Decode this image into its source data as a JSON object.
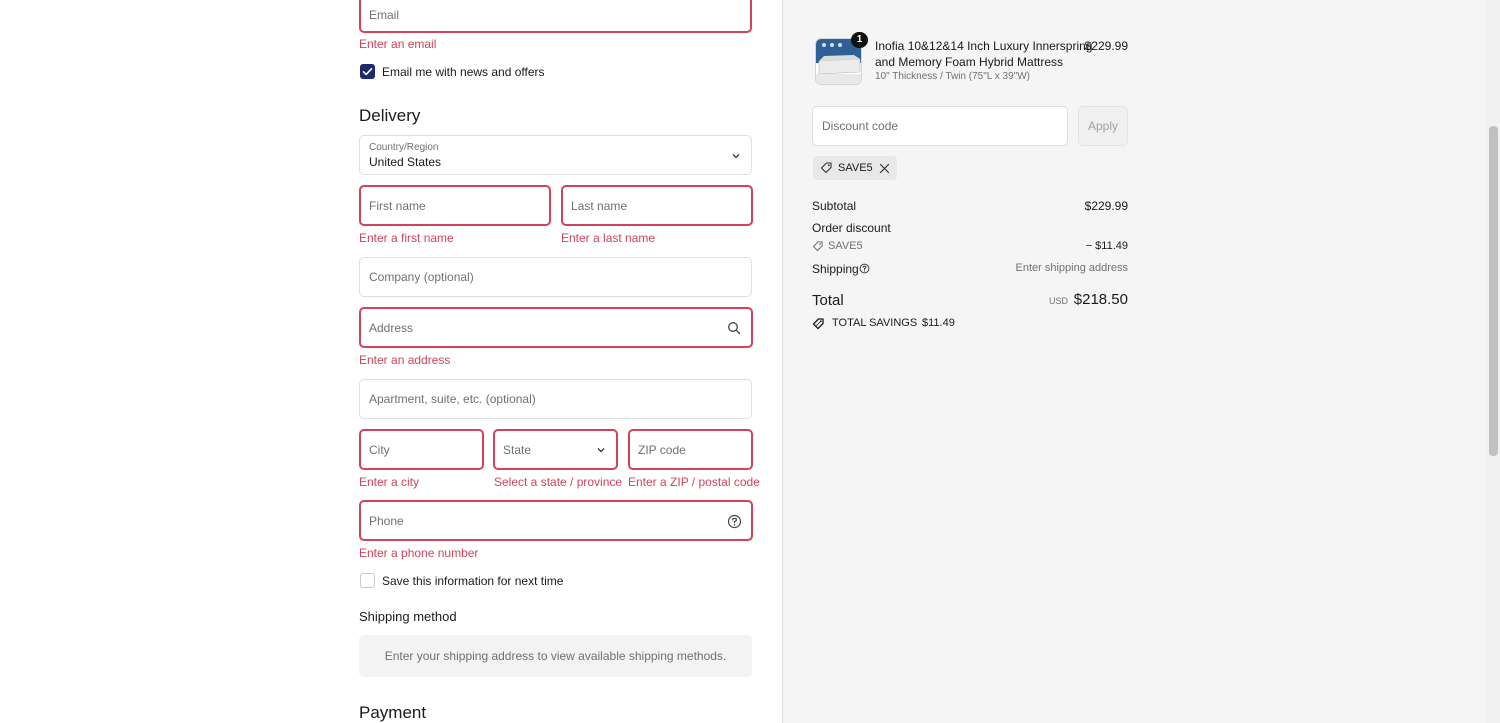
{
  "contact": {
    "email_placeholder": "Email",
    "email_error": "Enter an email",
    "news_label": "Email me with news and offers"
  },
  "delivery": {
    "heading": "Delivery",
    "country_label": "Country/Region",
    "country_value": "United States",
    "first_name_placeholder": "First name",
    "first_name_error": "Enter a first name",
    "last_name_placeholder": "Last name",
    "last_name_error": "Enter a last name",
    "company_placeholder": "Company (optional)",
    "address_placeholder": "Address",
    "address_error": "Enter an address",
    "apartment_placeholder": "Apartment, suite, etc. (optional)",
    "city_placeholder": "City",
    "city_error": "Enter a city",
    "state_placeholder": "State",
    "state_error": "Select a state / province",
    "zip_placeholder": "ZIP code",
    "zip_error": "Enter a ZIP / postal code",
    "phone_placeholder": "Phone",
    "phone_error": "Enter a phone number",
    "save_info_label": "Save this information for next time"
  },
  "shipping_method": {
    "heading": "Shipping method",
    "message": "Enter your shipping address to view available shipping methods."
  },
  "payment": {
    "heading": "Payment"
  },
  "summary": {
    "item": {
      "quantity": "1",
      "title_line1": "Inofia 10&12&14 Inch Luxury Innerspring",
      "title_line2": "and Memory Foam Hybrid Mattress",
      "variant": "10\" Thickness / Twin (75\"L x 39\"W)",
      "price": "$229.99"
    },
    "discount_placeholder": "Discount code",
    "apply_label": "Apply",
    "applied_code": "SAVE5",
    "subtotal_label": "Subtotal",
    "subtotal_value": "$229.99",
    "order_discount_label": "Order discount",
    "discount_code": "SAVE5",
    "discount_value": "− $11.49",
    "shipping_label": "Shipping",
    "shipping_value": "Enter shipping address",
    "total_label": "Total",
    "currency": "USD",
    "total_value": "$218.50",
    "savings_label": "TOTAL SAVINGS",
    "savings_value": "$11.49"
  },
  "colors": {
    "error": "#d1435b",
    "checkbox_checked": "#1d2a6d",
    "sidebar_bg": "#f5f5f5"
  }
}
